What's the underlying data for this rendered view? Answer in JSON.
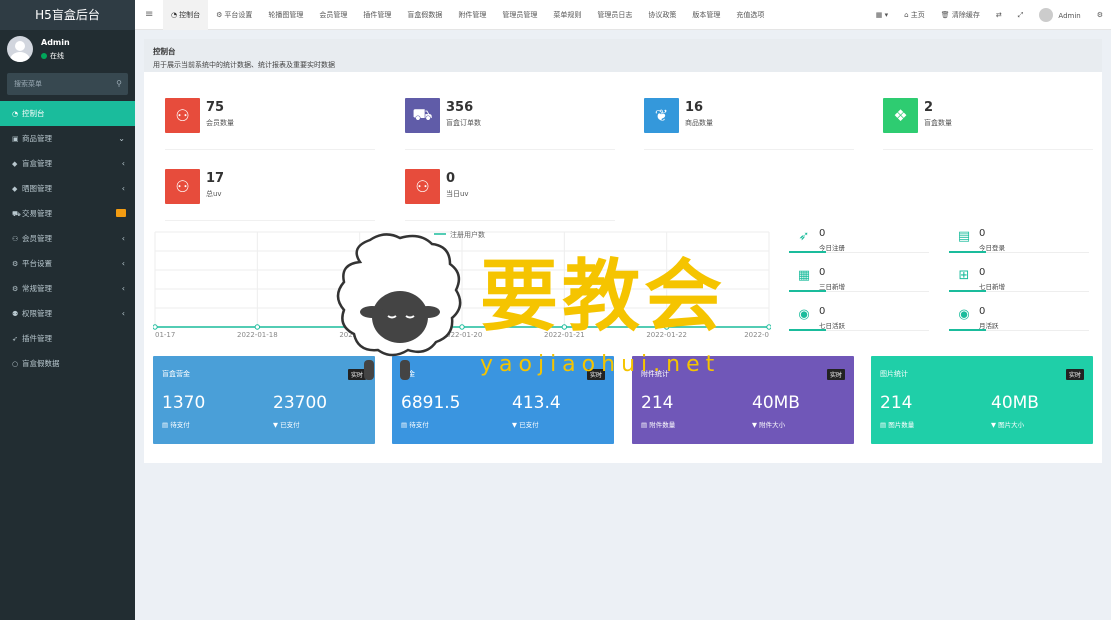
{
  "app": {
    "title": "H5盲盒后台"
  },
  "user": {
    "name": "Admin",
    "status": "在线"
  },
  "search": {
    "placeholder": "搜索菜单"
  },
  "sidebar": {
    "items": [
      {
        "label": "控制台",
        "icon": "dashboard-icon",
        "active": true
      },
      {
        "label": "商品管理",
        "icon": "shopping-bag-icon",
        "arrow": "chevron-down"
      },
      {
        "label": "盲盒管理",
        "icon": "gift-icon",
        "arrow": "chevron-left"
      },
      {
        "label": "晒图管理",
        "icon": "gift-icon",
        "arrow": "chevron-left"
      },
      {
        "label": "交易管理",
        "icon": "cart-icon",
        "badge": true
      },
      {
        "label": "会员管理",
        "icon": "users-icon",
        "arrow": "chevron-left"
      },
      {
        "label": "平台设置",
        "icon": "cogs-icon",
        "arrow": "chevron-left"
      },
      {
        "label": "常规管理",
        "icon": "cogs-icon",
        "arrow": "chevron-left"
      },
      {
        "label": "权限管理",
        "icon": "group-icon",
        "arrow": "chevron-left"
      },
      {
        "label": "插件管理",
        "icon": "rocket-icon"
      },
      {
        "label": "盲盒假数据",
        "icon": "circle-icon"
      }
    ]
  },
  "tabs": [
    {
      "label": "控制台",
      "icon": "dashboard-icon",
      "active": true
    },
    {
      "label": "平台设置",
      "icon": "gear-icon"
    },
    {
      "label": "轮播图管理"
    },
    {
      "label": "会员管理"
    },
    {
      "label": "插件管理"
    },
    {
      "label": "盲盒假数据"
    },
    {
      "label": "附件管理"
    },
    {
      "label": "管理员管理"
    },
    {
      "label": "菜单规则"
    },
    {
      "label": "管理员日志"
    },
    {
      "label": "协议政策"
    },
    {
      "label": "版本管理"
    },
    {
      "label": "充值选项"
    }
  ],
  "topright": {
    "home": "主页",
    "clear_cache": "清除缓存",
    "admin": "Admin"
  },
  "panel": {
    "title": "控制台",
    "subtitle": "用于展示当前系统中的统计数据、统计报表及重要实时数据"
  },
  "stats": [
    {
      "value": "75",
      "label": "会员数量",
      "color": "#e74c3c",
      "icon": "users-icon"
    },
    {
      "value": "356",
      "label": "盲盒订单数",
      "color": "#605ca8",
      "icon": "cart-icon"
    },
    {
      "value": "16",
      "label": "商品数量",
      "color": "#3498db",
      "icon": "leaf-icon"
    },
    {
      "value": "2",
      "label": "盲盒数量",
      "color": "#2ecc71",
      "icon": "dropbox-icon"
    },
    {
      "value": "17",
      "label": "总uv",
      "color": "#e74c3c",
      "icon": "users-icon"
    },
    {
      "value": "0",
      "label": "当日uv",
      "color": "#e74c3c",
      "icon": "users-icon"
    }
  ],
  "chart_data": {
    "type": "line",
    "legend": [
      "注册用户数"
    ],
    "categories": [
      "01-17",
      "2022-01-18",
      "2022-01-19",
      "2022-01-20",
      "2022-01-21",
      "2022-01-22",
      "2022-0"
    ],
    "series": [
      {
        "name": "注册用户数",
        "values": [
          0,
          0,
          0,
          0,
          0,
          0,
          0
        ]
      }
    ],
    "color": "#1abc9c"
  },
  "right_stats": [
    {
      "value": "0",
      "label": "今日注册",
      "icon": "rocket-icon"
    },
    {
      "value": "0",
      "label": "今日登录",
      "icon": "vcard-icon"
    },
    {
      "value": "0",
      "label": "三日新增",
      "icon": "calendar-icon"
    },
    {
      "value": "0",
      "label": "七日新增",
      "icon": "calendar-plus-icon"
    },
    {
      "value": "0",
      "label": "七日活跃",
      "icon": "user-circle-icon"
    },
    {
      "value": "0",
      "label": "月活跃",
      "icon": "user-circle-icon"
    }
  ],
  "cards": [
    {
      "title": "盲盒营金",
      "badge": "实时",
      "v1": "1370",
      "l1": "待支付",
      "v2": "23700",
      "l2": "已支付",
      "color": "#4a9fd8"
    },
    {
      "title": "资金",
      "badge": "实时",
      "v1": "6891.5",
      "l1": "待支付",
      "v2": "413.4",
      "l2": "已支付",
      "color": "#3a95e0"
    },
    {
      "title": "附件统计",
      "badge": "实时",
      "v1": "214",
      "l1": "附件数量",
      "v2": "40MB",
      "l2": "附件大小",
      "color": "#7057b8"
    },
    {
      "title": "图片统计",
      "badge": "实时",
      "v1": "214",
      "l1": "图片数量",
      "v2": "40MB",
      "l2": "图片大小",
      "color": "#1fcfa8"
    }
  ],
  "watermark": {
    "text": "要教会",
    "sub": "yaojiaohui.net"
  }
}
